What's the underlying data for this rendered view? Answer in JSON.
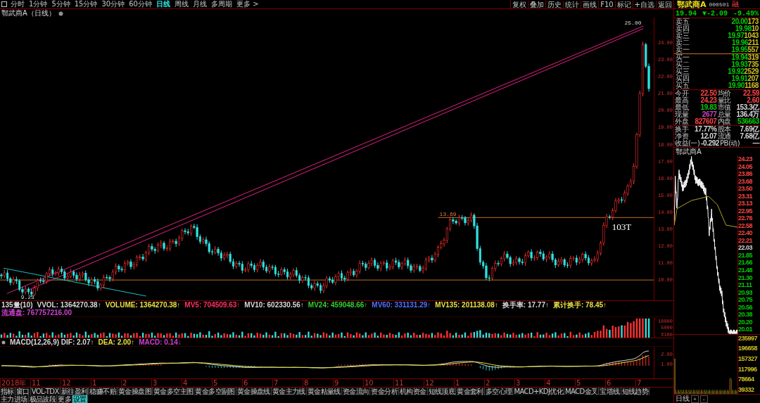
{
  "toolbar": {
    "periods": [
      {
        "label": "分时",
        "selected": false
      },
      {
        "label": "1分钟",
        "selected": false
      },
      {
        "label": "5分钟",
        "selected": false
      },
      {
        "label": "15分钟",
        "selected": false
      },
      {
        "label": "30分钟",
        "selected": false
      },
      {
        "label": "60分钟",
        "selected": false
      },
      {
        "label": "日线",
        "selected": true
      },
      {
        "label": "周线",
        "selected": false
      },
      {
        "label": "月线",
        "selected": false
      },
      {
        "label": "多周期",
        "selected": false
      },
      {
        "label": "更多 >",
        "selected": false
      }
    ],
    "tools": [
      "复权",
      "叠加",
      "历史",
      "统计",
      "画线",
      "F10",
      "标记",
      "+自选",
      "返回"
    ]
  },
  "chart": {
    "title": "鄂武商A（日线）",
    "price_axis": [
      "24.00",
      "23.00",
      "22.00",
      "21.00",
      "20.00",
      "19.00",
      "18.00",
      "17.00",
      "16.00",
      "15.00",
      "14.00",
      "13.00",
      "12.00",
      "11.00",
      "10.00"
    ],
    "markers": [
      {
        "kind": "peak",
        "text": "25.00"
      },
      {
        "kind": "trough",
        "text": "9.23"
      },
      {
        "kind": "level",
        "text": "13.69"
      },
      {
        "kind": "tag",
        "text": "103T"
      }
    ]
  },
  "volume": {
    "legend": [
      {
        "text": "135量(10)",
        "color": "#d8d8d8"
      },
      {
        "text": "VVOL: 1364270.38↑",
        "color": "#d8d8d8"
      },
      {
        "text": "VOLUME: 1364270.38↑",
        "color": "#e8e040"
      },
      {
        "text": "MV5: 704509.63↑",
        "color": "#ff3060"
      },
      {
        "text": "MV10: 602330.56↑",
        "color": "#d8d8d8"
      },
      {
        "text": "MV24: 459048.66↑",
        "color": "#30d030"
      },
      {
        "text": "MV60: 331131.29↑",
        "color": "#5070ff"
      },
      {
        "text": "MV135: 201138.08↑",
        "color": "#e8e040"
      },
      {
        "text": "换手率: 17.77↑",
        "color": "#d8d8d8"
      },
      {
        "text": "累计换手: 78.45↑",
        "color": "#e8e040"
      },
      {
        "text": "流通盘: 767757216.00",
        "color": "#d040d0"
      }
    ],
    "axis": [
      "10000",
      "5000",
      "X100"
    ]
  },
  "macd": {
    "legend": [
      {
        "text": "MACD(12,26,9) DIF: 2.07↑",
        "color": "#d8d8d8"
      },
      {
        "text": "DEA: 2.00↑",
        "color": "#e8e040"
      },
      {
        "text": "MACD: 0.14↓",
        "color": "#d040d0"
      }
    ],
    "axis": [
      "2.00",
      "1.00"
    ]
  },
  "x_axis": [
    "2018年",
    "11",
    "12",
    "1",
    "2",
    "3",
    "4",
    "5",
    "6",
    "7",
    "8",
    "9",
    "10",
    "11",
    "12",
    "1",
    "2",
    "3",
    "4",
    "5",
    "6",
    "7"
  ],
  "bottom_tabs": [
    {
      "label": "指标",
      "selected": false
    },
    {
      "label": "窗口",
      "selected": false
    },
    {
      "label": "VOL-TDX",
      "selected": false
    },
    {
      "label": "新往盈利",
      "selected": false
    },
    {
      "label": "稳赚不赔",
      "selected": false
    },
    {
      "label": "黄金操盘图",
      "selected": false
    },
    {
      "label": "黄金多空主图",
      "selected": false
    },
    {
      "label": "黄金多空副图",
      "selected": false
    },
    {
      "label": "黄金操盘线",
      "selected": false
    },
    {
      "label": "黄金主力线",
      "selected": false
    },
    {
      "label": "黄金粘量线",
      "selected": false
    },
    {
      "label": "资金流向",
      "selected": false
    },
    {
      "label": "资金分析",
      "selected": false
    },
    {
      "label": "机构资金",
      "selected": false
    },
    {
      "label": "短线顶底",
      "selected": false
    },
    {
      "label": "黄金套利",
      "selected": false
    },
    {
      "label": "多空心理",
      "selected": false
    },
    {
      "label": "MACD+KDJ优化",
      "selected": false
    },
    {
      "label": "MACD金叉",
      "selected": false
    },
    {
      "label": "宝塔线",
      "selected": false
    },
    {
      "label": "短线趋势",
      "selected": false
    },
    {
      "label": "主力进场",
      "selected": false
    },
    {
      "label": "极品波段",
      "selected": false
    },
    {
      "label": "更多",
      "selected": false
    },
    {
      "label": "设置",
      "selected": true
    }
  ],
  "quote": {
    "name": "鄂武商A",
    "code": "000501",
    "badge": "融",
    "price": "19.94",
    "change": "▼-2.09",
    "percent": "-9.49%",
    "color": "#00d000",
    "asks": [
      {
        "label": "卖五",
        "price": "20.00",
        "volume": "173"
      },
      {
        "label": "卖四",
        "price": "19.98",
        "volume": "10"
      },
      {
        "label": "卖三",
        "price": "19.97",
        "volume": "1043"
      },
      {
        "label": "卖二",
        "price": "19.96",
        "volume": "211"
      },
      {
        "label": "卖一",
        "price": "19.95",
        "volume": "557"
      }
    ],
    "bids": [
      {
        "label": "买一",
        "price": "19.94",
        "volume": "319"
      },
      {
        "label": "买二",
        "price": "19.93",
        "volume": "735"
      },
      {
        "label": "买三",
        "price": "19.92",
        "volume": "2529"
      },
      {
        "label": "买四",
        "price": "19.91",
        "volume": "207"
      },
      {
        "label": "买五",
        "price": "19.90",
        "volume": "1168"
      }
    ],
    "stat_groups": [
      {
        "rows": [
          [
            {
              "label": "今开",
              "value": "22.50",
              "color": "#ff4545"
            },
            {
              "label": "均价",
              "value": "22.59",
              "color": "#ff4545"
            }
          ],
          [
            {
              "label": "最高",
              "value": "24.23",
              "color": "#ff4545"
            },
            {
              "label": "量比",
              "value": "2.60",
              "color": "#ff4545"
            }
          ],
          [
            {
              "label": "最低",
              "value": "19.83",
              "color": "#00d000"
            },
            {
              "label": "市值",
              "value": "153.3亿",
              "color": "#d8d8d8"
            }
          ],
          [
            {
              "label": "现量",
              "value": "2677",
              "color": "#d040d0"
            },
            {
              "label": "总量",
              "value": "136.4万",
              "color": "#d8d8d8"
            }
          ],
          [
            {
              "label": "外盘",
              "value": "827607",
              "color": "#ff4545"
            },
            {
              "label": "内盘",
              "value": "536663",
              "color": "#00d000"
            }
          ]
        ]
      },
      {
        "rows": [
          [
            {
              "label": "换手",
              "value": "17.77%",
              "color": "#d8d8d8"
            },
            {
              "label": "股本",
              "value": "7.69亿",
              "color": "#d8d8d8"
            }
          ],
          [
            {
              "label": "净资",
              "value": "12.07",
              "color": "#d8d8d8"
            },
            {
              "label": "流通",
              "value": "7.68亿",
              "color": "#d8d8d8"
            }
          ],
          [
            {
              "label": "收益(一)",
              "value": "-0.292",
              "color": "#d8d8d8"
            },
            {
              "label": "PB(动)",
              "value": "—",
              "color": "#d8d8d8"
            }
          ]
        ]
      }
    ]
  },
  "intraday": {
    "title": "鄂武商A",
    "price_axis": [
      {
        "text": "24.23",
        "color": "#ff4545"
      },
      {
        "text": "24.05",
        "color": "#ff4545"
      },
      {
        "text": "23.86",
        "color": "#ff4545"
      },
      {
        "text": "23.68",
        "color": "#ff4545"
      },
      {
        "text": "23.50",
        "color": "#ff4545"
      },
      {
        "text": "23.31",
        "color": "#ff4545"
      },
      {
        "text": "23.13",
        "color": "#ff4545"
      },
      {
        "text": "22.95",
        "color": "#ff4545"
      },
      {
        "text": "22.76",
        "color": "#ff4545"
      },
      {
        "text": "22.58",
        "color": "#ff4545"
      },
      {
        "text": "22.40",
        "color": "#ff4545"
      },
      {
        "text": "22.21",
        "color": "#ff4545"
      },
      {
        "text": "22.03",
        "color": "#d8d8d8"
      },
      {
        "text": "21.85",
        "color": "#00d000"
      },
      {
        "text": "21.66",
        "color": "#00d000"
      },
      {
        "text": "21.48",
        "color": "#00d000"
      },
      {
        "text": "21.30",
        "color": "#00d000"
      },
      {
        "text": "21.11",
        "color": "#00d000"
      },
      {
        "text": "20.93",
        "color": "#00d000"
      },
      {
        "text": "20.75",
        "color": "#00d000"
      },
      {
        "text": "20.56",
        "color": "#00d000"
      },
      {
        "text": "20.38",
        "color": "#00d000"
      },
      {
        "text": "20.20",
        "color": "#00d000"
      },
      {
        "text": "20.01",
        "color": "#00d000"
      }
    ],
    "volume_axis": [
      "235997",
      "196658",
      "157327",
      "117996",
      "78664",
      "39332"
    ],
    "period": "日线",
    "zoom": [
      "+",
      "-"
    ]
  }
}
